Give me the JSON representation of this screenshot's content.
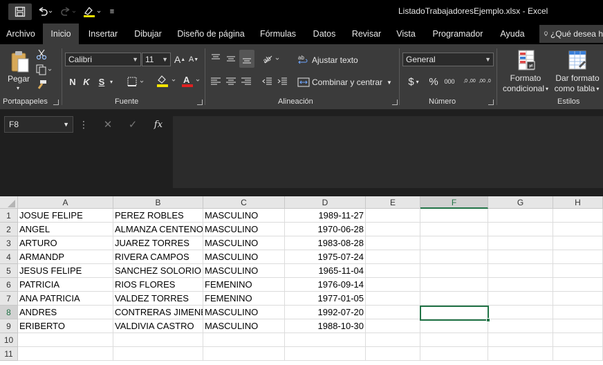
{
  "window": {
    "title": "ListadoTrabajadoresEjemplo.xlsx  -  Excel"
  },
  "quick_access": {
    "save_icon": "save-icon",
    "undo_icon": "undo-icon",
    "redo_icon": "redo-icon",
    "highlight_icon": "highlight-icon",
    "customize_icon": "customize-icon"
  },
  "tabs": [
    "Archivo",
    "Inicio",
    "Insertar",
    "Dibujar",
    "Diseño de página",
    "Fórmulas",
    "Datos",
    "Revisar",
    "Vista",
    "Programador",
    "Ayuda"
  ],
  "active_tab": "Inicio",
  "tell_me": "¿Qué desea h",
  "ribbon": {
    "clipboard": {
      "paste_label": "Pegar",
      "group_label": "Portapapeles"
    },
    "font": {
      "font_name": "Calibri",
      "font_size": "11",
      "bold": "N",
      "italic": "K",
      "underline": "S",
      "grow": "A",
      "shrink": "A",
      "group_label": "Fuente"
    },
    "alignment": {
      "wrap_text": "Ajustar texto",
      "merge_center": "Combinar y centrar",
      "group_label": "Alineación"
    },
    "number": {
      "format": "General",
      "currency": "$",
      "percent": "%",
      "thousands": "000",
      "increase_decimals": ",0 ,00",
      "decrease_decimals": ",00 ,0",
      "group_label": "Número"
    },
    "styles": {
      "conditional_1": "Formato",
      "conditional_2": "condicional",
      "table_1": "Dar formato",
      "table_2": "como tabla",
      "group_label": "Estilos"
    }
  },
  "formula_bar": {
    "name_box": "F8",
    "fx": "fx",
    "content": ""
  },
  "sheet": {
    "columns": [
      "A",
      "B",
      "C",
      "D",
      "E",
      "F",
      "G",
      "H"
    ],
    "selected_column": "F",
    "selected_row": "8",
    "rows": [
      {
        "n": "1",
        "a": "JOSUE FELIPE",
        "b": "PEREZ ROBLES",
        "c": "MASCULINO",
        "d": "1989-11-27"
      },
      {
        "n": "2",
        "a": "ANGEL",
        "b": "ALMANZA CENTENO",
        "c": "MASCULINO",
        "d": "1970-06-28"
      },
      {
        "n": "3",
        "a": "ARTURO",
        "b": "JUAREZ TORRES",
        "c": "MASCULINO",
        "d": "1983-08-28"
      },
      {
        "n": "4",
        "a": "ARMANDP",
        "b": "RIVERA CAMPOS",
        "c": "MASCULINO",
        "d": "1975-07-24"
      },
      {
        "n": "5",
        "a": "JESUS FELIPE",
        "b": "SANCHEZ SOLORIO",
        "c": "MASCULINO",
        "d": "1965-11-04"
      },
      {
        "n": "6",
        "a": "PATRICIA",
        "b": "RIOS FLORES",
        "c": "FEMENINO",
        "d": "1976-09-14"
      },
      {
        "n": "7",
        "a": "ANA PATRICIA",
        "b": "VALDEZ TORRES",
        "c": "FEMENINO",
        "d": "1977-01-05"
      },
      {
        "n": "8",
        "a": "ANDRES",
        "b": "CONTRERAS JIMENEZ",
        "c": "MASCULINO",
        "d": "1992-07-20"
      },
      {
        "n": "9",
        "a": "ERIBERTO",
        "b": "VALDIVIA CASTRO",
        "c": "MASCULINO",
        "d": "1988-10-30"
      },
      {
        "n": "10",
        "a": "",
        "b": "",
        "c": "",
        "d": ""
      },
      {
        "n": "11",
        "a": "",
        "b": "",
        "c": "",
        "d": ""
      }
    ]
  }
}
